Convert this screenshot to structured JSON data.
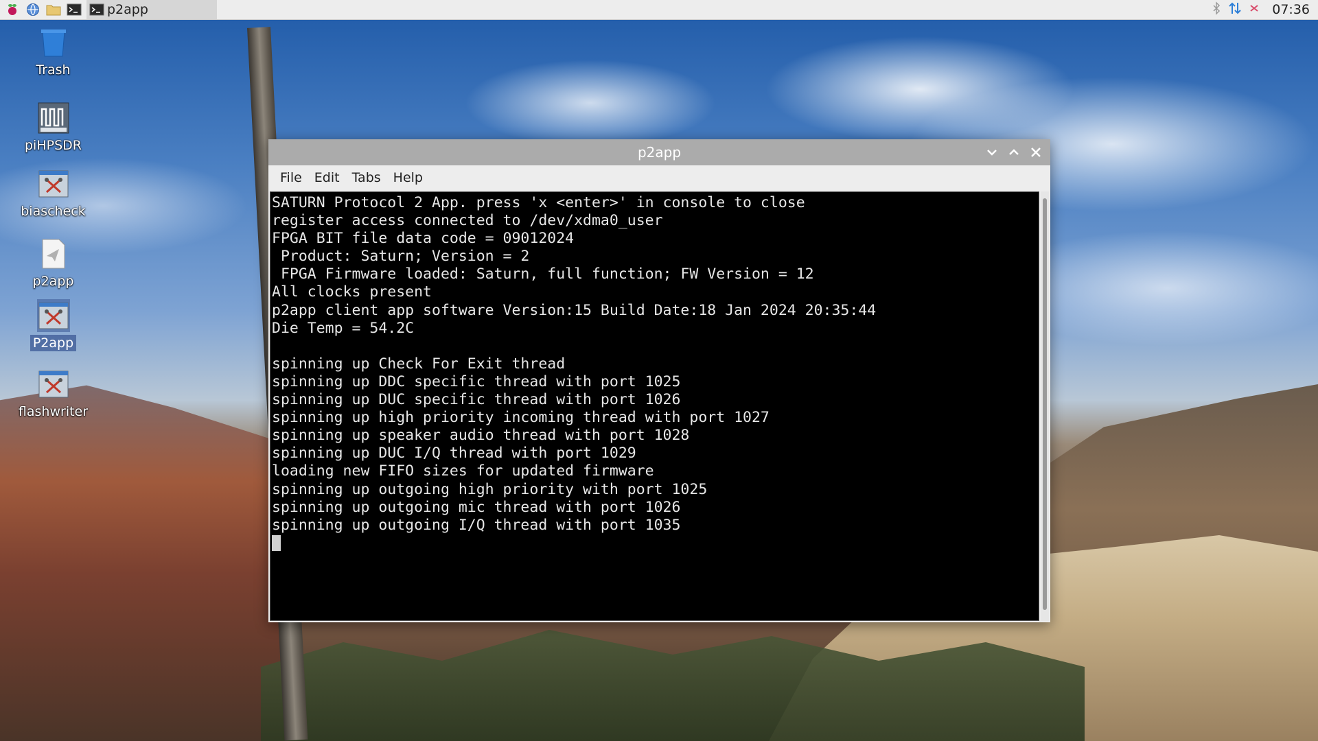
{
  "taskbar": {
    "launchers": [
      "raspberry-menu-icon",
      "web-browser-icon",
      "file-manager-icon",
      "terminal-icon"
    ],
    "task_label": "p2app",
    "clock": "07:36"
  },
  "desktop": {
    "icons": [
      {
        "label": "Trash",
        "icon": "trash-icon"
      },
      {
        "label": "piHPSDR",
        "icon": "pihpsdr-icon"
      },
      {
        "label": "biascheck",
        "icon": "tool-icon"
      },
      {
        "label": "p2app",
        "icon": "paper-plane-icon"
      },
      {
        "label": "P2app",
        "icon": "tool-icon"
      },
      {
        "label": "flashwriter",
        "icon": "tool-icon"
      }
    ]
  },
  "window": {
    "title": "p2app",
    "menu": [
      "File",
      "Edit",
      "Tabs",
      "Help"
    ],
    "lines": [
      "SATURN Protocol 2 App. press 'x <enter>' in console to close",
      "register access connected to /dev/xdma0_user",
      "FPGA BIT file data code = 09012024",
      " Product: Saturn; Version = 2",
      " FPGA Firmware loaded: Saturn, full function; FW Version = 12",
      "All clocks present",
      "p2app client app software Version:15 Build Date:18 Jan 2024 20:35:44",
      "Die Temp = 54.2C",
      "",
      "spinning up Check For Exit thread",
      "spinning up DDC specific thread with port 1025",
      "spinning up DUC specific thread with port 1026",
      "spinning up high priority incoming thread with port 1027",
      "spinning up speaker audio thread with port 1028",
      "spinning up DUC I/Q thread with port 1029",
      "loading new FIFO sizes for updated firmware",
      "spinning up outgoing high priority with port 1025",
      "spinning up outgoing mic thread with port 1026",
      "spinning up outgoing I/Q thread with port 1035"
    ]
  }
}
